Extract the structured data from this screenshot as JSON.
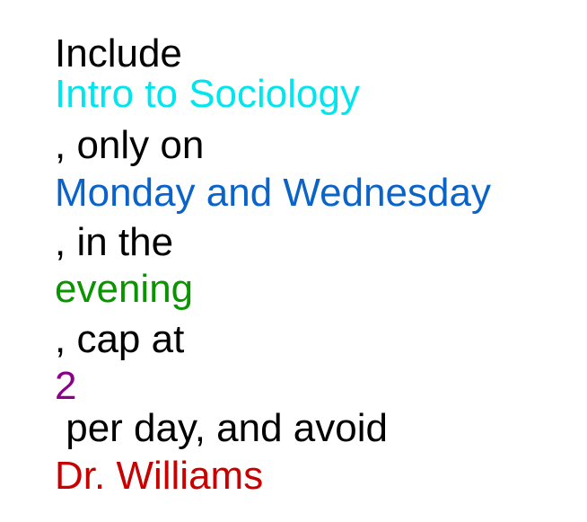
{
  "instruction": {
    "segments": [
      {
        "text": "Include",
        "color": "#000000"
      },
      {
        "text": "Intro to Sociology",
        "color": "#00E5EE"
      },
      {
        "text": ", only on",
        "color": "#000000"
      },
      {
        "text": "Monday and Wednesday",
        "color": "#0A63C8"
      },
      {
        "text": ", in the",
        "color": "#000000"
      },
      {
        "text": "evening",
        "color": "#0A9400"
      },
      {
        "text": ", cap at",
        "color": "#000000"
      },
      {
        "text": "2",
        "color": "#8A008A"
      },
      {
        "text": " per day, and avoid",
        "color": "#000000"
      },
      {
        "text": "Dr. Williams",
        "color": "#C80000"
      }
    ]
  }
}
